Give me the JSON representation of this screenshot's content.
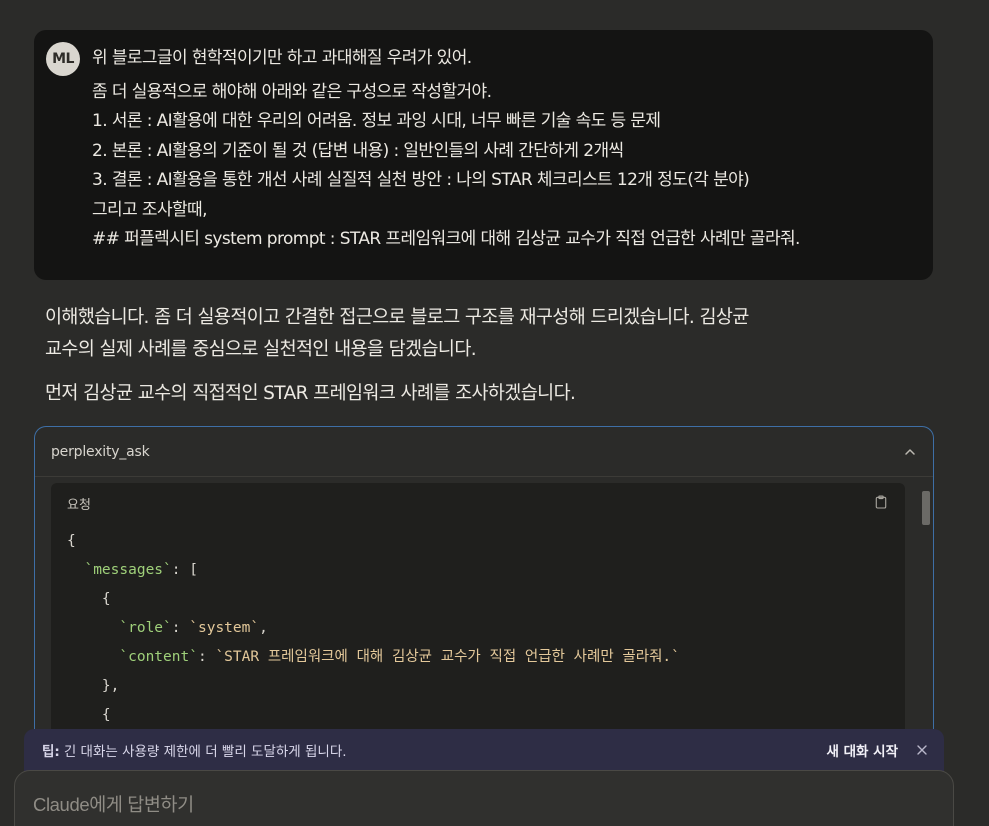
{
  "user_message": {
    "avatar": "ML",
    "first_line": "위 블로그글이 현학적이기만 하고 과대해질 우려가 있어.",
    "lines": [
      "좀 더 실용적으로 해야해  아래와 같은 구성으로 작성할거야.",
      "1. 서론 : AI활용에 대한 우리의 어려움. 정보 과잉 시대, 너무 빠른 기술 속도 등 문제",
      "2. 본론 : AI활용의 기준이 될 것 (답변 내용) : 일반인들의 사례 간단하게  2개씩",
      "3. 결론 : AI활용을 통한 개선 사례 실질적 실천 방안 : 나의 STAR 체크리스트 12개 정도(각 분야)",
      "그리고 조사할때,",
      "## 퍼플렉시티 system prompt : STAR 프레임워크에 대해 김상균 교수가 직접 언급한 사례만 골라줘."
    ]
  },
  "assistant": {
    "para1_line1": "이해했습니다. 좀 더 실용적이고 간결한 접근으로 블로그 구조를 재구성해 드리겠습니다. 김상균",
    "para1_line2": "교수의 실제 사례를 중심으로 실천적인 내용을 담겠습니다.",
    "para2": "먼저 김상균 교수의 직접적인 STAR 프레임워크 사례를 조사하겠습니다."
  },
  "tool_call": {
    "name": "perplexity_ask",
    "chevron_icon": "chevron-up-icon",
    "request_label": "요청",
    "copy_icon": "clipboard-icon",
    "code": {
      "open_brace": "{",
      "messages_key": "`messages`",
      "messages_open": ": [",
      "obj_open": "{",
      "role_key": "`role`",
      "role_value": "`system`",
      "content_key": "`content`",
      "content_value": "`STAR 프레임워크에 대해 김상균 교수가 직접 언급한 사례만 골라줘.`",
      "obj_close": "},",
      "obj2_open": "{"
    }
  },
  "tip": {
    "label": "팁:",
    "text": "긴 대화는 사용량 제한에 더 빨리 도달하게 됩니다.",
    "action": "새 대화 시작",
    "close_icon": "close-icon"
  },
  "composer": {
    "placeholder": "Claude에게 답변하기"
  }
}
